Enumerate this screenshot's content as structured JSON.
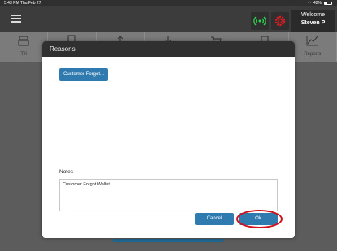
{
  "status_bar": {
    "time_date": "5:43 PM  Thu Feb 27",
    "battery": "42%"
  },
  "header": {
    "welcome": "Welcome",
    "user": "Steven P"
  },
  "toolbar": {
    "tools": [
      "Till",
      "",
      "",
      "",
      "",
      "",
      "Reports"
    ]
  },
  "modal": {
    "title": "Reasons",
    "reason_button": "Customer Forgot...",
    "notes_label": "Notes",
    "notes_value": "Customer Forgot Wallet",
    "cancel_label": "Cancel",
    "ok_label": "Ok"
  },
  "colors": {
    "accent": "#2f7bb0",
    "highlight": "#d0101a",
    "wifi_green": "#2fd152",
    "gear_red": "#e11b22"
  }
}
